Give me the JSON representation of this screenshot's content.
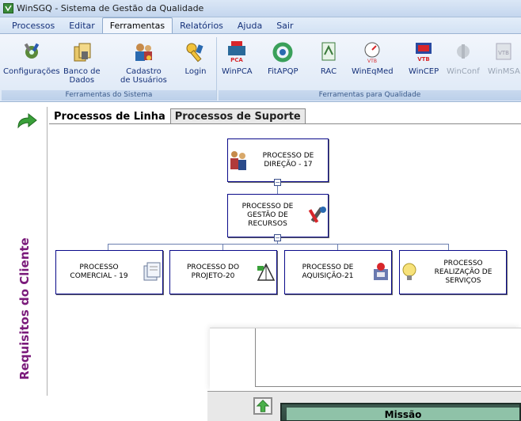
{
  "window": {
    "title": "WinSGQ  - Sistema de Gestão da Qualidade"
  },
  "menu": [
    "Processos",
    "Editar",
    "Ferramentas",
    "Relatórios",
    "Ajuda",
    "Sair"
  ],
  "menu_active": "Ferramentas",
  "ribbon": {
    "system_group": {
      "label": "Ferramentas do Sistema",
      "buttons": [
        "Configurações",
        "Banco de\nDados",
        "Cadastro\nde Usuários",
        "Login"
      ]
    },
    "quality_group": {
      "label": "Ferramentas para Qualidade",
      "buttons": [
        "WinPCA",
        "FitAPQP",
        "RAC",
        "WinEqMed",
        "WinCEP",
        "WinConf",
        "WinMSA"
      ]
    }
  },
  "tabs": [
    "Processos de Linha",
    "Processos de Suporte"
  ],
  "processes": {
    "direcao": "PROCESSO DE\nDIREÇÃO - 17",
    "recursos": "PROCESSO DE\nGESTÃO DE\nRECURSOS",
    "comercial": "PROCESSO\nCOMERCIAL - 19",
    "projeto": "PROCESSO DO\nPROJETO-20",
    "aquisicao": "PROCESSO DE\nAQUISIÇÃO-21",
    "servicos": "PROCESSO\nREALIZAÇÃO DE\nSERVIÇOS"
  },
  "side_label": "Requisitos do Cliente",
  "bottom_pane": {
    "title": "Missão"
  },
  "colors": {
    "side_label": "#7a1a7a",
    "box_border": "#0a0a8a",
    "missao_bg": "#8fc2a8"
  }
}
